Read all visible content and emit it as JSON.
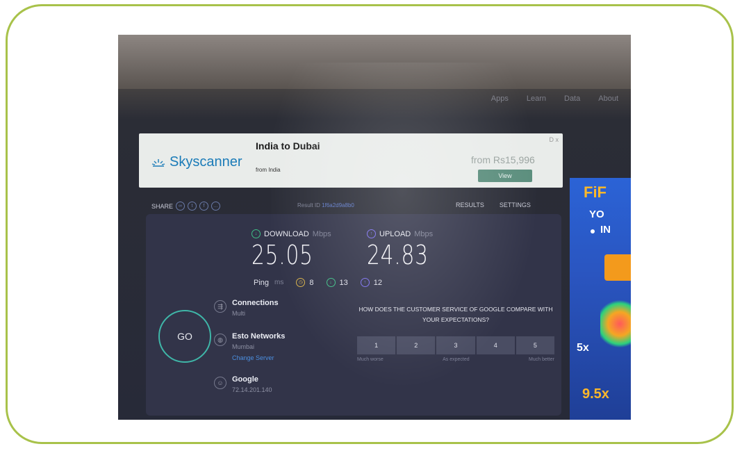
{
  "nav": [
    "Apps",
    "Learn",
    "Data",
    "About"
  ],
  "ad": {
    "brand": "Skyscanner",
    "title": "India to Dubai",
    "subtitle": "from India",
    "price": "from Rs15,996",
    "button": "View",
    "close": "D x"
  },
  "share": {
    "label": "SHARE",
    "icons": [
      "link-icon",
      "twitter-icon",
      "facebook-icon",
      "more-icon"
    ]
  },
  "result": {
    "label": "Result ID",
    "id": "1f6a2d9a8b0"
  },
  "tabs": {
    "results": "RESULTS",
    "settings": "SETTINGS"
  },
  "download": {
    "label": "DOWNLOAD",
    "unit": "Mbps",
    "value": "25.05",
    "color": "#3fbf86"
  },
  "upload": {
    "label": "UPLOAD",
    "unit": "Mbps",
    "value": "24.83",
    "color": "#7b6ff0"
  },
  "ping": {
    "label": "Ping",
    "unit": "ms",
    "idle": "8",
    "download": "13",
    "upload": "12"
  },
  "go_label": "GO",
  "connections": {
    "title": "Connections",
    "value": "Multi"
  },
  "server": {
    "title": "Esto Networks",
    "location": "Mumbai",
    "change": "Change Server"
  },
  "isp": {
    "title": "Google",
    "ip": "72.14.201.140"
  },
  "survey": {
    "question": "HOW DOES THE CUSTOMER SERVICE OF GOOGLE COMPARE WITH YOUR EXPECTATIONS?",
    "options": [
      "1",
      "2",
      "3",
      "4",
      "5"
    ],
    "low": "Much worse",
    "mid": "As expected",
    "high": "Much better"
  },
  "side_ad": {
    "line1": "FiF",
    "line2": "YO",
    "line3": "IN",
    "promo1": "5x",
    "promo2": "9.5x"
  }
}
